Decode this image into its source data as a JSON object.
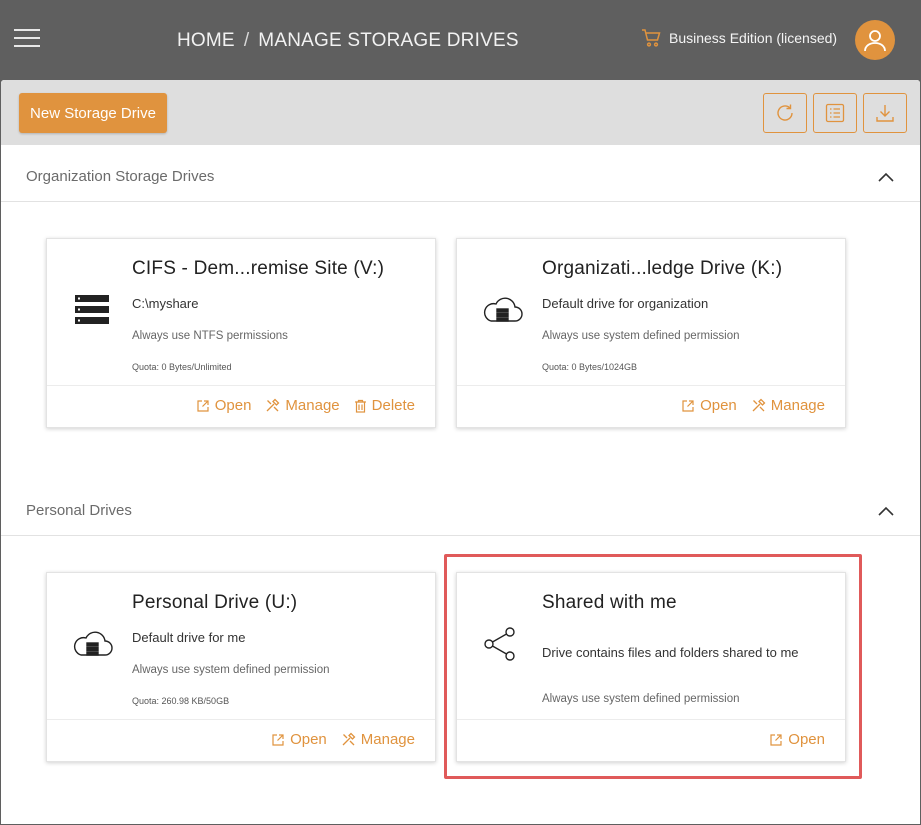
{
  "header": {
    "breadcrumb_home": "HOME",
    "breadcrumb_sep": "/",
    "breadcrumb_current": "MANAGE STORAGE DRIVES",
    "edition": "Business Edition (licensed)"
  },
  "toolbar": {
    "new_label": "New Storage Drive"
  },
  "sections": {
    "org": {
      "title": "Organization Storage Drives",
      "cards": [
        {
          "title": "CIFS - Dem...remise Site  (V:)",
          "desc": "C:\\myshare",
          "perm": "Always use NTFS permissions",
          "quota": "Quota: 0 Bytes/Unlimited",
          "open": "Open",
          "manage": "Manage",
          "delete": "Delete"
        },
        {
          "title": "Organizati...ledge Drive  (K:)",
          "desc": "Default drive for organization",
          "perm": "Always use system defined permission",
          "quota": "Quota: 0 Bytes/1024GB",
          "open": "Open",
          "manage": "Manage"
        }
      ]
    },
    "personal": {
      "title": "Personal Drives",
      "cards": [
        {
          "title": "Personal Drive  (U:)",
          "desc": "Default drive for me",
          "perm": "Always use system defined permission",
          "quota": "Quota: 260.98 KB/50GB",
          "open": "Open",
          "manage": "Manage"
        },
        {
          "title": "Shared with me",
          "desc": "Drive contains files and folders shared to me",
          "perm": "Always use system defined permission",
          "open": "Open"
        }
      ]
    }
  },
  "colors": {
    "accent": "#e0933e",
    "topbar": "#5f5f5f",
    "highlight": "#e05a5a"
  }
}
